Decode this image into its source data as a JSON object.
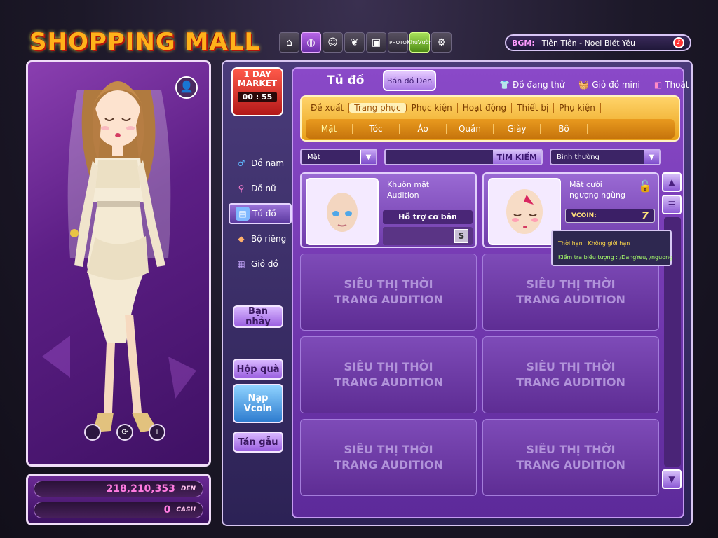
{
  "header": {
    "logo": "SHOPPING MALL",
    "bgm_label": "BGM:",
    "bgm_song": "Tiên Tiên - Noel Biết Yêu"
  },
  "top_icons": [
    "home-icon",
    "egg-icon",
    "face-icon",
    "leaf-icon",
    "tv-icon",
    "photo-icon",
    "khuvuon-icon",
    "gear-icon"
  ],
  "top_icon_text": {
    "photo": "PHOTO",
    "khuvuon": "KhuVườn"
  },
  "oneday": {
    "line1": "1 DAY",
    "line2": "MARKET",
    "timer": "00 : 55"
  },
  "wallet": {
    "den": "218,210,353",
    "den_label": "DEN",
    "cash": "0",
    "cash_label": "CASH"
  },
  "categories": [
    {
      "label": "Đồ nam",
      "icon": "male-icon"
    },
    {
      "label": "Đồ nữ",
      "icon": "female-icon"
    },
    {
      "label": "Tủ đồ",
      "icon": "wardrobe-icon"
    },
    {
      "label": "Bộ riêng",
      "icon": "set-icon"
    },
    {
      "label": "Giỏ đồ",
      "icon": "basket-icon"
    }
  ],
  "side_buttons": {
    "ban_nhay": "Bạn nhảy",
    "hop_qua": "Hộp quà",
    "nap_line1": "Nạp",
    "nap_line2": "Vcoin",
    "tan_gau": "Tán gẫu"
  },
  "store": {
    "title": "Tủ đồ",
    "btn_den": "Bán đồ Den",
    "link_try": "Đồ đang thử",
    "link_mini": "Giỏ đồ mini",
    "link_exit": "Thoát"
  },
  "tabs": [
    "Đề xuất",
    "Trang phục",
    "Phục kiện",
    "Hoạt động",
    "Thiết bị",
    "Phụ kiện"
  ],
  "active_tab": "Trang phục",
  "subtabs": [
    "Mặt",
    "Tóc",
    "Áo",
    "Quần",
    "Giày",
    "Bô"
  ],
  "filter": {
    "category": "Mặt",
    "search_label": "TÌM KIẾM",
    "sort": "Bình thường"
  },
  "items": [
    {
      "name_line1": "Khuôn mặt",
      "name_line2": "Audition",
      "tag": "Hỗ trợ cơ bản",
      "badge": "S"
    },
    {
      "name_line1": "Mặt cười",
      "name_line2": "ngượng ngùng",
      "vcoin_label": "VCOIN:",
      "price": "7"
    }
  ],
  "placeholder": {
    "line1": "SIÊU THỊ THỜI",
    "line2": "TRANG AUDITION"
  },
  "tooltip": {
    "line1": "Thời hạn : Không giới hạn",
    "line2": "Kiểm tra biểu tượng : /DangYeu, /nguong"
  }
}
